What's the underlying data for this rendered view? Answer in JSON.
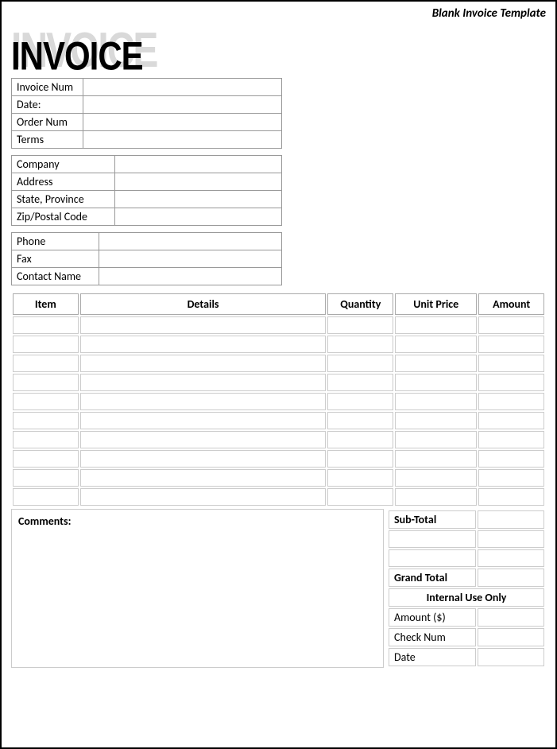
{
  "header_label": "Blank Invoice Template",
  "logo_text": "INVOICE",
  "info1": {
    "invoice_num": {
      "label": "Invoice Num",
      "value": ""
    },
    "date": {
      "label": "Date:",
      "value": ""
    },
    "order_num": {
      "label": "Order Num",
      "value": ""
    },
    "terms": {
      "label": "Terms",
      "value": ""
    }
  },
  "info2": {
    "company": {
      "label": "Company",
      "value": ""
    },
    "address": {
      "label": "Address",
      "value": ""
    },
    "state": {
      "label": "State, Province",
      "value": ""
    },
    "zip": {
      "label": "Zip/Postal Code",
      "value": ""
    }
  },
  "info3": {
    "phone": {
      "label": "Phone",
      "value": ""
    },
    "fax": {
      "label": "Fax",
      "value": ""
    },
    "contact": {
      "label": "Contact Name",
      "value": ""
    }
  },
  "items_header": {
    "item": "Item",
    "details": "Details",
    "qty": "Quantity",
    "price": "Unit Price",
    "amount": "Amount"
  },
  "items": [
    {
      "item": "",
      "details": "",
      "qty": "",
      "price": "",
      "amount": ""
    },
    {
      "item": "",
      "details": "",
      "qty": "",
      "price": "",
      "amount": ""
    },
    {
      "item": "",
      "details": "",
      "qty": "",
      "price": "",
      "amount": ""
    },
    {
      "item": "",
      "details": "",
      "qty": "",
      "price": "",
      "amount": ""
    },
    {
      "item": "",
      "details": "",
      "qty": "",
      "price": "",
      "amount": ""
    },
    {
      "item": "",
      "details": "",
      "qty": "",
      "price": "",
      "amount": ""
    },
    {
      "item": "",
      "details": "",
      "qty": "",
      "price": "",
      "amount": ""
    },
    {
      "item": "",
      "details": "",
      "qty": "",
      "price": "",
      "amount": ""
    },
    {
      "item": "",
      "details": "",
      "qty": "",
      "price": "",
      "amount": ""
    },
    {
      "item": "",
      "details": "",
      "qty": "",
      "price": "",
      "amount": ""
    }
  ],
  "comments_label": "Comments:",
  "totals": {
    "subtotal": {
      "label": "Sub-Total",
      "value": ""
    },
    "blank1": {
      "label": "",
      "value": ""
    },
    "blank2": {
      "label": "",
      "value": ""
    },
    "grand": {
      "label": "Grand Total",
      "value": ""
    },
    "internal_hdr": "Internal Use Only",
    "amount": {
      "label": "Amount ($)",
      "value": ""
    },
    "check": {
      "label": "Check Num",
      "value": ""
    },
    "date": {
      "label": "Date",
      "value": ""
    }
  }
}
